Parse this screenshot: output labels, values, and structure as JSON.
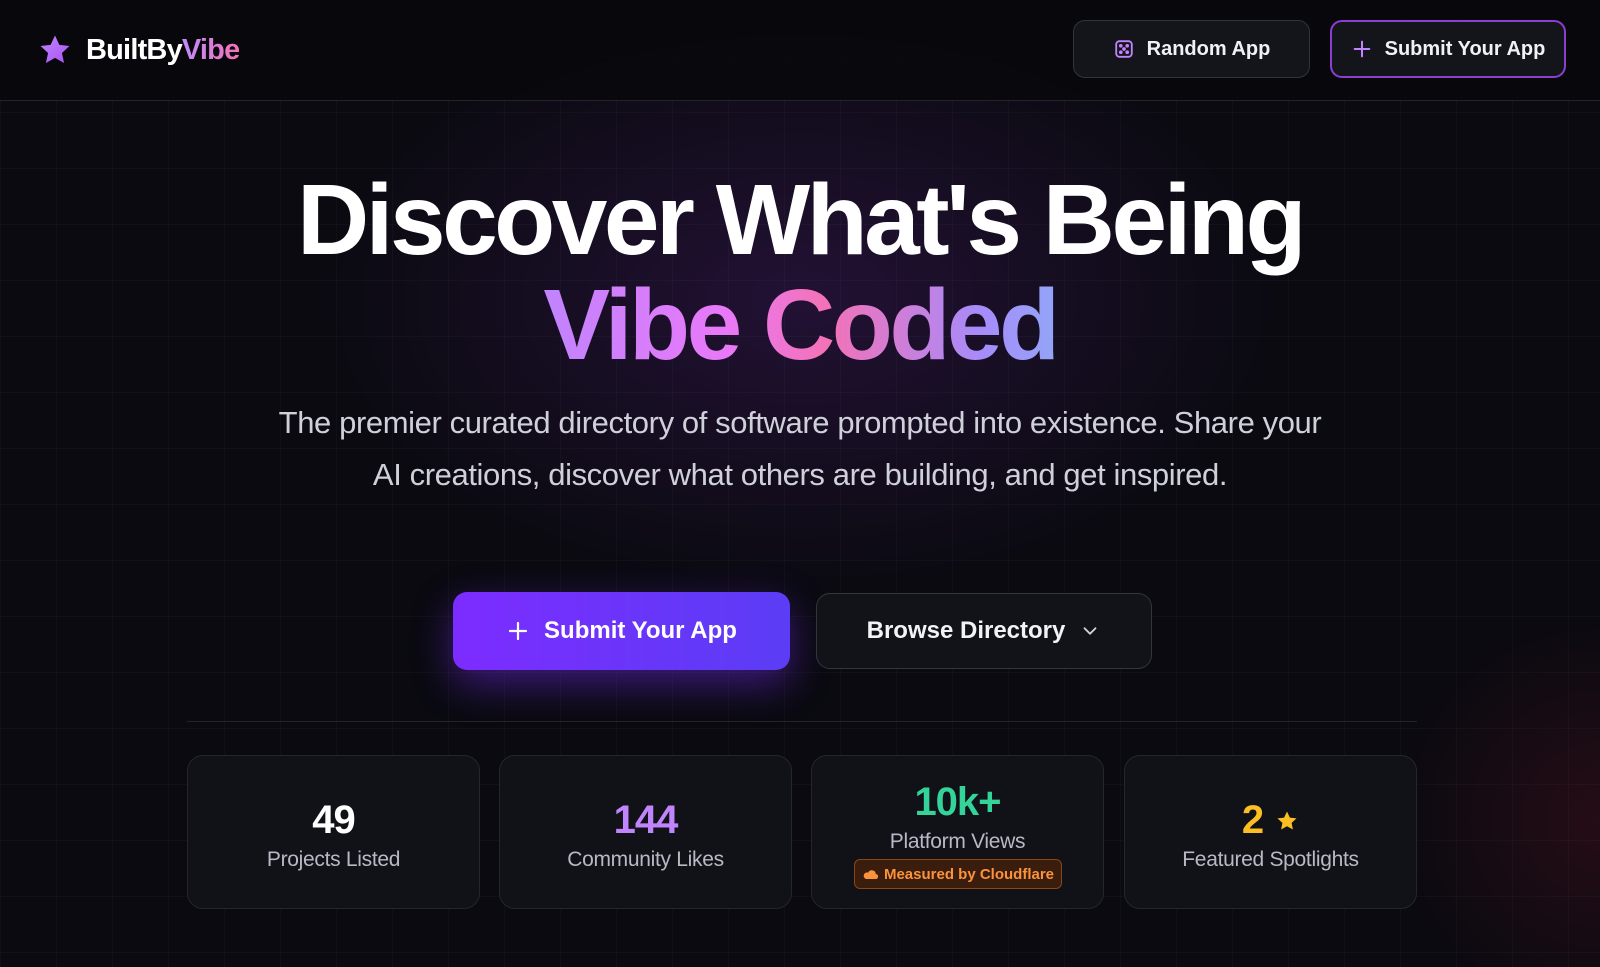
{
  "header": {
    "brand_part1": "BuiltBy",
    "brand_part2": "Vibe",
    "random_label": "Random App",
    "submit_label": "Submit Your App"
  },
  "hero": {
    "title_line1": "Discover What's Being",
    "title_line2": "Vibe Coded",
    "subtitle": "The premier curated directory of software prompted into existence. Share your AI creations, discover what others are building, and get inspired.",
    "primary_cta": "Submit Your App",
    "secondary_cta": "Browse Directory"
  },
  "stats": [
    {
      "value": "49",
      "label": "Projects Listed",
      "color": "#ffffff"
    },
    {
      "value": "144",
      "label": "Community Likes",
      "color": "#c084fc"
    },
    {
      "value": "10k+",
      "label": "Platform Views",
      "color": "#34d399",
      "badge": "Measured by Cloudflare"
    },
    {
      "value": "2",
      "label": "Featured Spotlights",
      "color": "#fbbf24"
    }
  ],
  "icons": {
    "logo": "star-icon",
    "random": "dice-icon",
    "submit": "plus-icon",
    "browse": "chevron-down-icon",
    "badge": "cloud-icon",
    "featured": "star-icon"
  },
  "colors": {
    "accent": "#7c2cff",
    "brand_gradient_start": "#c084fc",
    "brand_gradient_end": "#f472b6"
  }
}
